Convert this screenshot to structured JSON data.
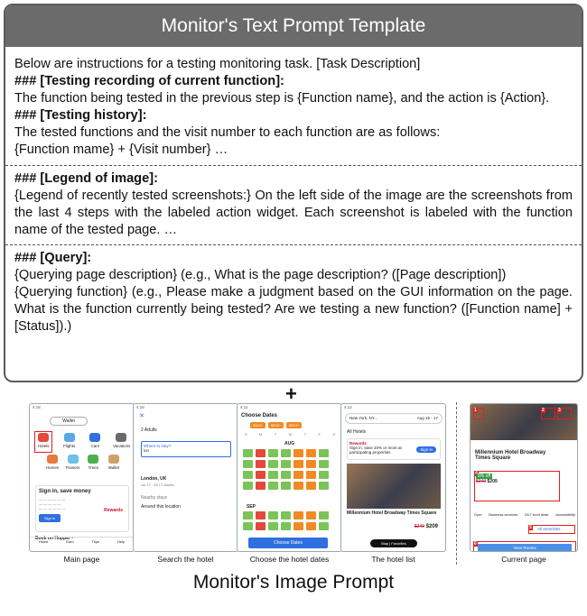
{
  "text_prompt": {
    "title": "Monitor's Text Prompt Template",
    "intro": "Below are instructions for a testing monitoring task. [Task Description]",
    "recording_heading": "### [Testing recording of current function]:",
    "recording_body": "The function being tested in the previous step is {Function name}, and the action is {Action}.",
    "history_heading": "### [Testing history]:",
    "history_body_1": "The tested functions and the visit number to each function are as follows:",
    "history_body_2": "{Function mame} + {Visit number} …",
    "legend_heading": "### [Legend of image]:",
    "legend_body": "{Legend of recently tested screenshots:} On the left side of the image are the screenshots from the last 4 steps with the labeled action widget. Each screenshot is labeled with the function name of the tested page. …",
    "query_heading": "### [Query]:",
    "query_body_1": "{Querying page description} (e.g., What is the page description? ([Page description])",
    "query_body_2": "{Querying function} (e.g., Please make a judgment based on the GUI information on the page. What is the function currently being tested? Are we testing a new function? ([Function name]  + [Status]).)"
  },
  "plus_sign": "+",
  "image_prompt": {
    "title": "Monitor's Image Prompt",
    "captions": [
      "Main page",
      "Search the hotel",
      "Choose the hotel dates",
      "The hotel list",
      "Current page"
    ],
    "main_page": {
      "wallet": "Wallet",
      "icons": [
        {
          "label": "Hotels",
          "icon": "hotel-icon"
        },
        {
          "label": "Flights",
          "icon": "plane-icon"
        },
        {
          "label": "Cars",
          "icon": "car-icon"
        },
        {
          "label": "Vacations",
          "icon": "binoculars-icon"
        }
      ],
      "icons_row2": [
        "Homes",
        "Flowers",
        "Trees",
        "Wallet"
      ],
      "card_title": "Sign in, save money",
      "card_rewards": "Rewards",
      "card_button": "Sign in",
      "book_text": "Book on Hopper -",
      "nav": [
        "Home",
        "Earn",
        "Trips",
        "Help"
      ]
    },
    "search_page": {
      "guests": "2 Adults",
      "input_hint": "Where to stay?",
      "input_value": "lon",
      "location": "London, UK",
      "location_sub": "Jul 27 - 28 • 2 Adults",
      "nearby": "Nearby stays",
      "around": "Around this location"
    },
    "dates_page": {
      "title": "Choose Dates",
      "chips": [
        "$113+",
        "$206+",
        "$313+"
      ],
      "weekdays": [
        "S",
        "M",
        "T",
        "W",
        "T",
        "F",
        "S"
      ],
      "month1": "AUG",
      "month2": "SEP",
      "button": "Choose Dates"
    },
    "list_page": {
      "search": "New York, NY...",
      "dates": "Aug 15 - 17",
      "all_hotels": "All Hotels",
      "rewards_title": "Rewards",
      "rewards_body": "Sign in, save 10% or more at participating properties",
      "rewards_btn": "Sign in",
      "hotel": "Millennium Hotel Broadway Times Square",
      "old_price": "$249",
      "price": "$209",
      "map": "Map",
      "favorites": "Favorites"
    },
    "current_page": {
      "hotel": "Millennium Hotel Broadway Times Square",
      "deal": "5% off",
      "old_price": "$249",
      "price": "$209",
      "amenities": [
        "Gym",
        "Business services",
        "24/7 front desk",
        "Accessibility"
      ],
      "all_amenities": "All amenities",
      "view_rooms": "View Rooms",
      "markers": [
        "1",
        "2",
        "3",
        "4",
        "5",
        "6"
      ]
    }
  }
}
